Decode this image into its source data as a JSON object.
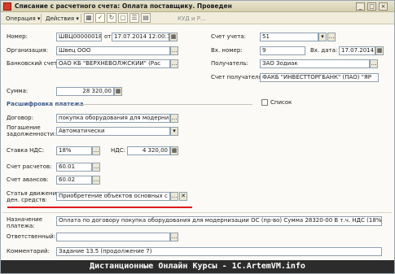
{
  "window": {
    "title": "Списание с расчетного счета: Оплата поставщику. Проведен",
    "controls": [
      "_",
      "□",
      "×"
    ]
  },
  "toolbar": {
    "operation_label": "Операция ▾",
    "actions_label": "Действия ▾",
    "kudir_label": "КУД и Р...",
    "icons": [
      "save-icon",
      "post-icon",
      "refresh-icon",
      "copy-icon",
      "structure-icon",
      "ledger-icon"
    ]
  },
  "form": {
    "number_label": "Номер:",
    "number_value": "ШВЦ00000018",
    "date_from_label": "от",
    "date_value": "17.07.2014 12:00:15",
    "account_label": "Счет учета:",
    "account_value": "51",
    "org_label": "Организация:",
    "org_value": "Швец ООО",
    "in_number_label": "Вх. номер:",
    "in_number_value": "9",
    "in_date_label": "Вх. дата:",
    "in_date_value": "17.07.2014",
    "bank_account_label": "Банковский счет:",
    "bank_account_value": "ОАО КБ \"ВЕРХНЕВОЛЖСКИЙ\" (Рас",
    "recipient_label": "Получатель:",
    "recipient_value": "ЗАО Зодиак",
    "recipient_account_label": "Счет получателя:",
    "recipient_account_value": "ФАКБ \"ИНВЕСТТОРГБАНК\" (ПАО) \"ЯР",
    "sum_label": "Сумма:",
    "sum_value": "28 320,00",
    "breakdown_title": "Расшифровка платежа",
    "list_label": "Список",
    "contract_label": "Договор:",
    "contract_value": "покупка оборудования для модерни",
    "debt_label_1": "Погашение",
    "debt_label_2": "задолженности:",
    "debt_value": "Автоматически",
    "vat_rate_label": "Ставка НДС:",
    "vat_rate_value": "18%",
    "vat_label": "НДС:",
    "vat_value": "4 320,00",
    "settlements_label": "Счет расчетов:",
    "settlements_value": "60.01",
    "advances_label": "Счет авансов:",
    "advances_value": "60.02",
    "cashflow_label_1": "Статья движения",
    "cashflow_label_2": "ден. средств:",
    "cashflow_value": "Приобретение объектов основных с",
    "purpose_label_1": "Назначение",
    "purpose_label_2": "платежа:",
    "purpose_value": "Оплата по договору покупка оборудования для модернизации ОС (пр-во) Сумма 28320-00 В т.ч. НДС  (18%) 4320-00",
    "responsible_label": "Ответственный:",
    "responsible_value": "",
    "comment_label": "Комментарий:",
    "comment_value": "Задание 13.5 (продолжение 7)"
  },
  "banner": "Дистанционные Онлайн Курсы - 1C.ArtemVM.info",
  "colors": {
    "title_bg": "#d6cfae",
    "section_title": "#3d5a8a",
    "highlight": "#e1191c",
    "banner_bg": "#2c2c2c"
  }
}
